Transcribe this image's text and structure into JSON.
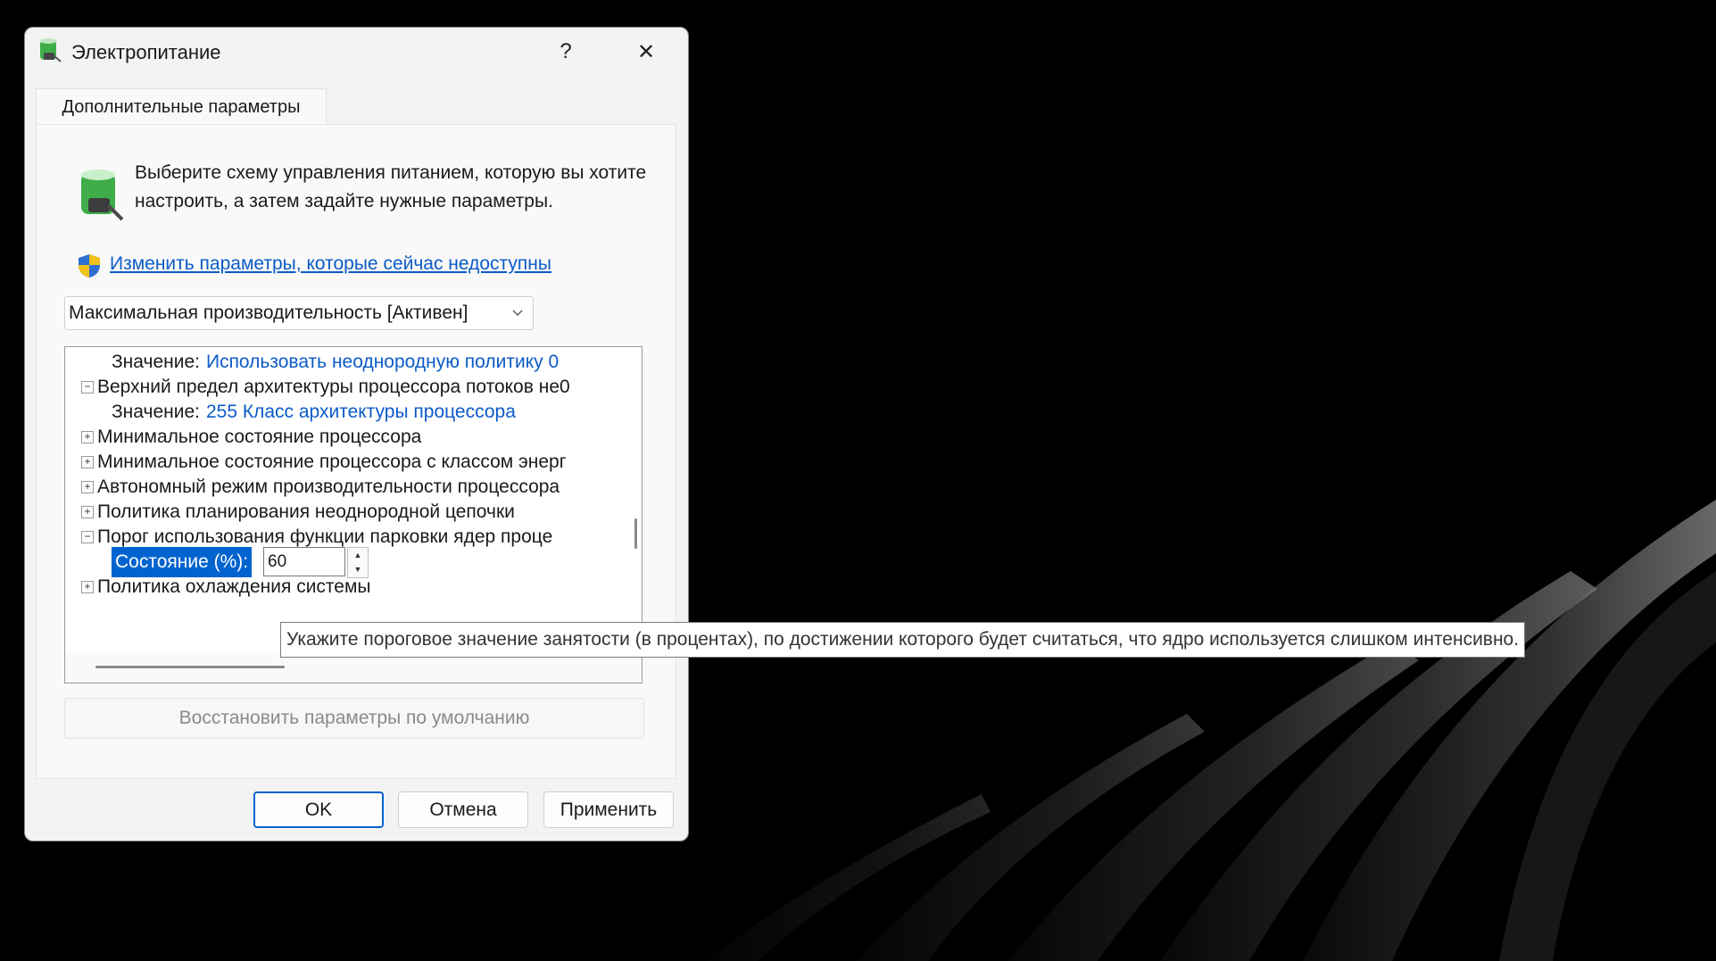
{
  "window": {
    "title": "Электропитание",
    "help_glyph": "?",
    "close_glyph": "✕"
  },
  "tab": {
    "label": "Дополнительные параметры"
  },
  "intro": {
    "text": "Выберите схему управления питанием, которую вы хотите настроить, а затем задайте нужные параметры.",
    "link": "Изменить параметры, которые сейчас недоступны"
  },
  "plan_select": {
    "value": "Максимальная производительность [Активен]"
  },
  "tree": {
    "row0": {
      "label": "Значение:",
      "value": "Использовать неоднородную политику 0"
    },
    "row1": {
      "label": "Верхний предел архитектуры процессора потоков не0"
    },
    "row2": {
      "label": "Значение:",
      "value": "255 Класс архитектуры процессора"
    },
    "row3": {
      "label": "Минимальное состояние процессора"
    },
    "row4": {
      "label": "Минимальное состояние процессора с классом энерг"
    },
    "row5": {
      "label": "Автономный режим производительности процессора"
    },
    "row6": {
      "label": "Политика планирования неоднородной цепочки"
    },
    "row7": {
      "label": "Порог использования функции парковки ядер проце"
    },
    "state": {
      "label": "Состояние (%):",
      "value": "60"
    },
    "row9": {
      "label": "Политика охлаждения системы"
    },
    "minus": "−",
    "plus": "+"
  },
  "restore_button": "Восстановить параметры по умолчанию",
  "buttons": {
    "ok": "OK",
    "cancel": "Отмена",
    "apply": "Применить"
  },
  "tooltip": "Укажите пороговое значение занятости (в процентах), по достижении которого будет считаться, что ядро используется слишком интенсивно."
}
